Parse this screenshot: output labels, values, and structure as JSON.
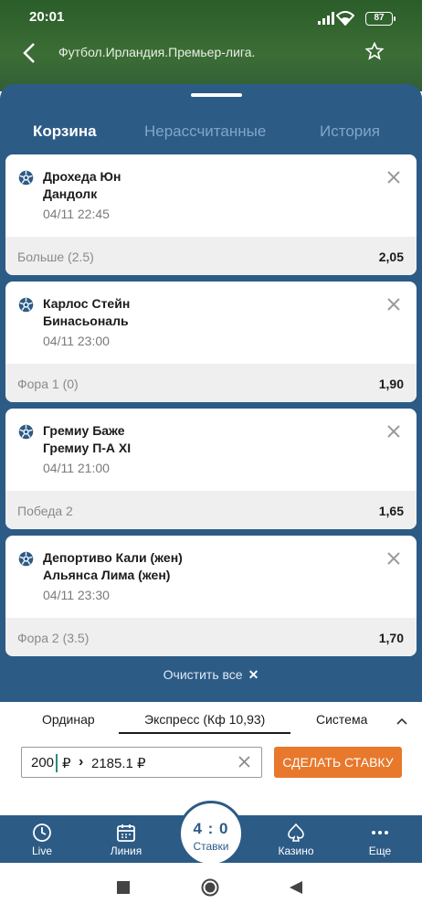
{
  "status": {
    "time": "20:01",
    "battery": "87"
  },
  "appbar": {
    "title": "Футбол.Ирландия.Премьер-лига."
  },
  "tabs": [
    {
      "label": "Корзина",
      "active": true
    },
    {
      "label": "Нерассчитанные",
      "active": false
    },
    {
      "label": "История",
      "active": false
    }
  ],
  "bets": [
    {
      "team1": "Дрохеда Юн",
      "team2": "Дандолк",
      "date": "04/11 22:45",
      "market": "Больше (2.5)",
      "odds": "2,05"
    },
    {
      "team1": "Карлос Стейн",
      "team2": "Бинасьональ",
      "date": "04/11 23:00",
      "market": "Фора 1 (0)",
      "odds": "1,90"
    },
    {
      "team1": "Гремиу Баже",
      "team2": "Гремиу П-А XI",
      "date": "04/11 21:00",
      "market": "Победа 2",
      "odds": "1,65"
    },
    {
      "team1": "Депортиво Кали (жен)",
      "team2": "Альянса Лима (жен)",
      "date": "04/11 23:30",
      "market": "Фора 2 (3.5)",
      "odds": "1,70"
    }
  ],
  "clear_all": "Очистить все",
  "bet_types": [
    {
      "label": "Ординар"
    },
    {
      "label": "Экспресс (Кф 10,93)",
      "active": true
    },
    {
      "label": "Система"
    }
  ],
  "stake": {
    "amount": "200",
    "currency": "₽",
    "arrow": "›",
    "payout": "2185.1 ₽"
  },
  "place_bet": "СДЕЛАТЬ СТАВКУ",
  "nav": {
    "live": "Live",
    "line": "Линия",
    "score": "4 : 0",
    "bets": "Ставки",
    "casino": "Казино",
    "more": "Еще"
  },
  "colors": {
    "primary": "#2c5b86",
    "accent": "#e8782c",
    "header": "#3c6d35"
  }
}
